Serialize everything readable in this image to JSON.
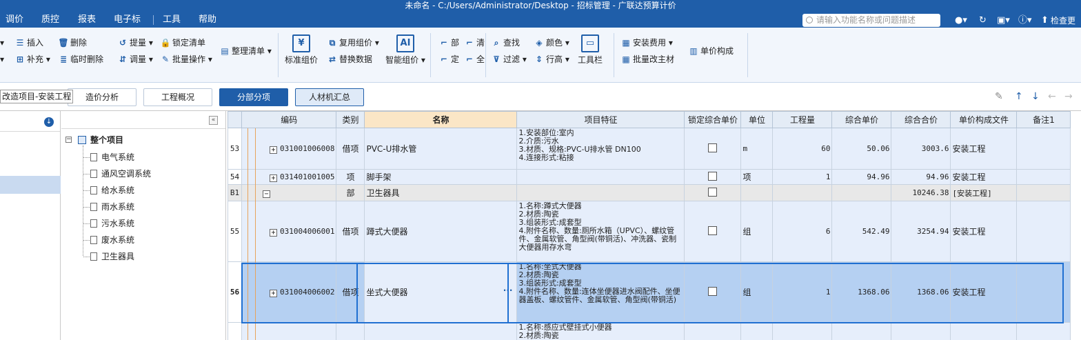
{
  "title": "未命名 - C:/Users/Administrator/Desktop - 招标管理 - 广联达预算计价",
  "menu": [
    "调价",
    "质控",
    "报表",
    "电子标",
    "工具",
    "帮助"
  ],
  "search_placeholder": "请输入功能名称或问题描述",
  "check_update": "检查更新",
  "ribbon": {
    "insert": "插入",
    "delete": "删除",
    "supplement": "补充",
    "temp_delete": "临时删除",
    "extract": "提量",
    "lock_list": "锁定清单",
    "adjust": "调量",
    "batch_op": "批量操作",
    "sort_list": "整理清单",
    "std_price": "标准组价",
    "reuse_price": "复用组价",
    "replace_data": "替换数据",
    "smart_price": "智能组价",
    "bu": "部",
    "qing": "清",
    "ding": "定",
    "quan": "全",
    "find": "查找",
    "color": "颜色",
    "filter": "过滤",
    "row_height": "行高",
    "toolbar": "工具栏",
    "install_fee": "安装费用",
    "batch_main": "批量改主材",
    "unit_comp": "单价构成"
  },
  "tabs": {
    "cost_analysis": "造价分析",
    "overview": "工程概况",
    "sub_items": "分部分项",
    "labor_summary": "人材机汇总"
  },
  "left": {
    "tooltip": "改造项目-安装工程"
  },
  "tree": {
    "root": "整个项目",
    "items": [
      "电气系统",
      "通风空调系统",
      "给水系统",
      "雨水系统",
      "污水系统",
      "废水系统",
      "卫生器具"
    ]
  },
  "grid": {
    "headers": [
      "编码",
      "类别",
      "名称",
      "项目特征",
      "锁定综合单价",
      "单位",
      "工程量",
      "综合单价",
      "综合合价",
      "单价构成文件",
      "备注1"
    ],
    "rows": [
      {
        "rn": "53",
        "code": "031001006008",
        "cat": "借项",
        "name": "PVC-U排水管",
        "feat": "1.安装部位:室内\n2.介质:污水\n3.材质、规格:PVC-U排水管 DN100\n4.连接形式:粘接",
        "unit": "m",
        "qty": "60",
        "price": "50.06",
        "total": "3003.6",
        "file": "安装工程"
      },
      {
        "rn": "54",
        "code": "031401001005",
        "cat": "项",
        "name": "脚手架",
        "feat": "",
        "unit": "项",
        "qty": "1",
        "price": "94.96",
        "total": "94.96",
        "file": "安装工程"
      },
      {
        "rn": "B1",
        "code": "",
        "cat": "部",
        "name": "卫生器具",
        "feat": "",
        "unit": "",
        "qty": "",
        "price": "",
        "total": "10246.38",
        "file": "[安装工程]"
      },
      {
        "rn": "55",
        "code": "031004006001",
        "cat": "借项",
        "name": "蹲式大便器",
        "feat": "1.名称:蹲式大便器\n2.材质:陶瓷\n3.组装形式:成套型\n4.附件名称、数量:厕所水箱（UPVC）、螺纹管件、金属软管、角型阀(带铜活)、冲洗器、瓷制大便器用存水弯",
        "unit": "组",
        "qty": "6",
        "price": "542.49",
        "total": "3254.94",
        "file": "安装工程"
      },
      {
        "rn": "56",
        "code": "031004006002",
        "cat": "借项",
        "name": "坐式大便器",
        "feat": "1.名称:坐式大便器\n2.材质:陶瓷\n3.组装形式:成套型\n4.附件名称、数量:连体坐便器进水阀配件、坐便器盖板、螺纹管件、金属软管、角型阀(带铜活)",
        "unit": "组",
        "qty": "1",
        "price": "1368.06",
        "total": "1368.06",
        "file": "安装工程"
      },
      {
        "rn": "",
        "code": "",
        "cat": "",
        "name": "",
        "feat": "1.名称:感应式壁挂式小便器\n2.材质:陶瓷",
        "unit": "",
        "qty": "",
        "price": "",
        "total": "",
        "file": ""
      }
    ]
  }
}
